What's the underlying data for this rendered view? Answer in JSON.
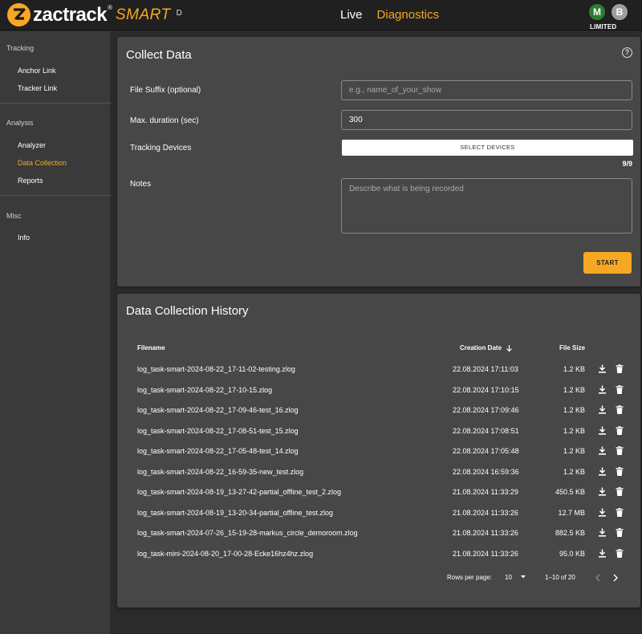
{
  "header": {
    "brand": "zactrack",
    "brand_reg": "®",
    "product": "SMART",
    "product_sub": "D",
    "nav": {
      "live": "Live",
      "diagnostics": "Diagnostics"
    },
    "avatars": [
      "M",
      "B"
    ],
    "license": "LIMITED",
    "colors": {
      "accent": "#f7a823",
      "avatar_m": "#2e7d32",
      "avatar_b": "#9e9e9e"
    }
  },
  "sidebar": {
    "sections": [
      {
        "title": "Tracking",
        "items": [
          "Anchor Link",
          "Tracker Link"
        ]
      },
      {
        "title": "Analysis",
        "items": [
          "Analyzer",
          "Data Collection",
          "Reports"
        ]
      },
      {
        "title": "Misc",
        "items": [
          "Info"
        ]
      }
    ],
    "active_item": "Data Collection"
  },
  "collect": {
    "title": "Collect Data",
    "help_icon": "help-circle-icon",
    "suffix_label": "File Suffix (optional)",
    "suffix_placeholder": "e.g., name_of_your_show",
    "duration_label": "Max. duration (sec)",
    "duration_value": "300",
    "devices_label": "Tracking Devices",
    "devices_button": "SELECT DEVICES",
    "devices_count": "9/9",
    "notes_label": "Notes",
    "notes_placeholder": "Describe what is being recorded",
    "start_button": "START"
  },
  "history": {
    "title": "Data Collection History",
    "columns": {
      "filename": "Filename",
      "date": "Creation Date",
      "size": "File Size"
    },
    "sort_icon": "arrow-down-icon",
    "rows": [
      {
        "name": "log_task-smart-2024-08-22_17-11-02-testing.zlog",
        "date": "22.08.2024 17:11:03",
        "size": "1.2 KB"
      },
      {
        "name": "log_task-smart-2024-08-22_17-10-15.zlog",
        "date": "22.08.2024 17:10:15",
        "size": "1.2 KB"
      },
      {
        "name": "log_task-smart-2024-08-22_17-09-46-test_16.zlog",
        "date": "22.08.2024 17:09:46",
        "size": "1.2 KB"
      },
      {
        "name": "log_task-smart-2024-08-22_17-08-51-test_15.zlog",
        "date": "22.08.2024 17:08:51",
        "size": "1.2 KB"
      },
      {
        "name": "log_task-smart-2024-08-22_17-05-48-test_14.zlog",
        "date": "22.08.2024 17:05:48",
        "size": "1.2 KB"
      },
      {
        "name": "log_task-smart-2024-08-22_16-59-35-new_test.zlog",
        "date": "22.08.2024 16:59:36",
        "size": "1.2 KB"
      },
      {
        "name": "log_task-smart-2024-08-19_13-27-42-partial_offline_test_2.zlog",
        "date": "21.08.2024 11:33:29",
        "size": "450.5 KB"
      },
      {
        "name": "log_task-smart-2024-08-19_13-20-34-partial_offline_test.zlog",
        "date": "21.08.2024 11:33:26",
        "size": "12.7 MB"
      },
      {
        "name": "log_task-smart-2024-07-26_15-19-28-markus_circle_demoroom.zlog",
        "date": "21.08.2024 11:33:26",
        "size": "882.5 KB"
      },
      {
        "name": "log_task-mini-2024-08-20_17-00-28-Ecke16hz4hz.zlog",
        "date": "21.08.2024 11:33:26",
        "size": "95.0 KB"
      }
    ],
    "pagination": {
      "rows_per_page_label": "Rows per page:",
      "rows_per_page": "10",
      "range": "1–10 of 20"
    }
  }
}
